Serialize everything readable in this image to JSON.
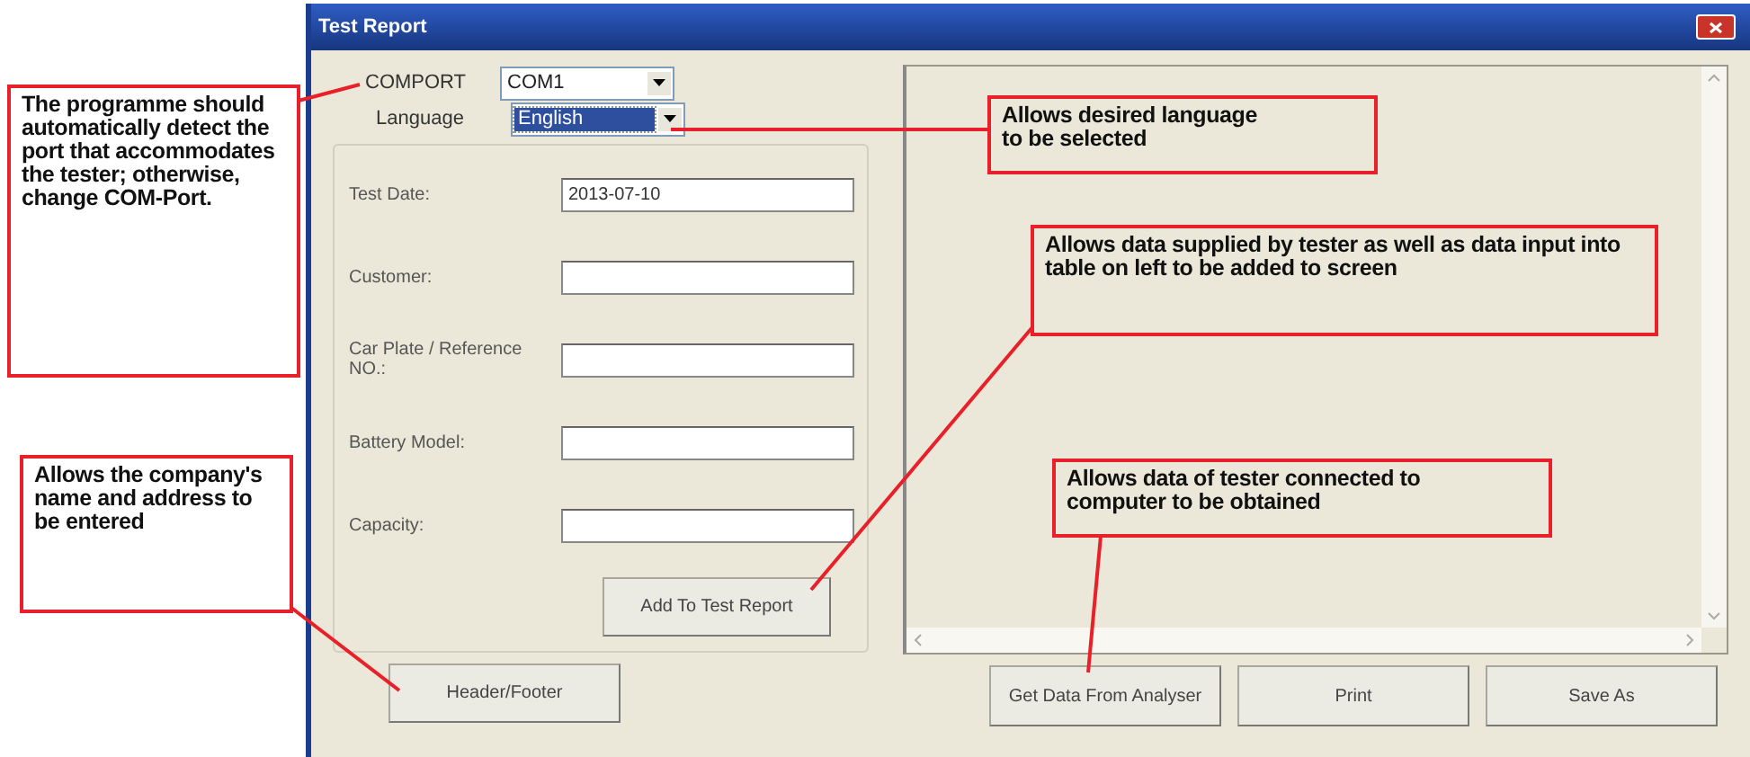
{
  "window": {
    "title": "Test Report"
  },
  "settings": [
    {
      "label": "COMPORT",
      "value": "COM1",
      "focused": false
    },
    {
      "label": "Language",
      "value": "English",
      "focused": true
    }
  ],
  "fields": [
    {
      "label": "Test Date:",
      "value": "2013-07-10"
    },
    {
      "label": "Customer:"
    },
    {
      "label": "Car Plate / Reference NO.:"
    },
    {
      "label": "Battery Model:"
    },
    {
      "label": "Capacity:"
    }
  ],
  "add_button": "Add To Test Report",
  "header_footer_button": "Header/Footer",
  "actions": [
    "Get Data From Analyser",
    "Print",
    "Save As"
  ],
  "callouts": [
    {
      "text": "The programme should automatically detect the port that accommodates the tester; otherwise, change COM-Port."
    },
    {
      "text": "Allows the company's name and address to be entered"
    },
    {
      "text": "Allows desired language to be selected"
    },
    {
      "text": "Allows data supplied by tester as well as data input into table on left to be added to screen"
    },
    {
      "text": "Allows data of tester connected to computer to be obtained"
    }
  ]
}
